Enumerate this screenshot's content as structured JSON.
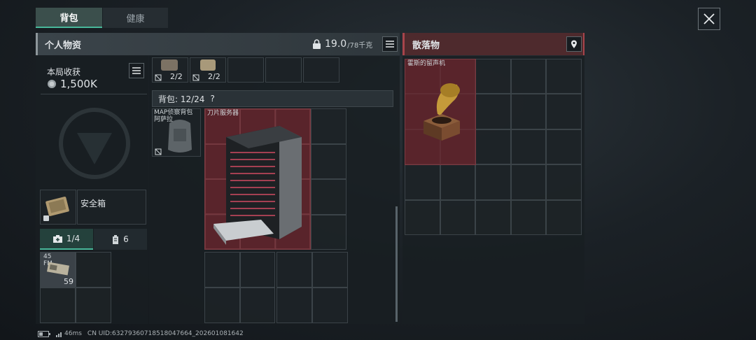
{
  "tabs": {
    "backpack": "背包",
    "health": "健康"
  },
  "personal": {
    "title": "个人物资",
    "weight_value": "19.0",
    "weight_capacity": "/78千克"
  },
  "loot": {
    "title": "散落物",
    "item_name": "霍斯的留声机"
  },
  "earnings": {
    "label": "本局收获",
    "value": "1,500K"
  },
  "ammo_counts": [
    "2/2",
    "2/2"
  ],
  "backpack": {
    "label": "背包: 12/24",
    "help": "?",
    "bag_name": "MAP侦察背包\n阿萨拉",
    "server_name": "刀片服务器"
  },
  "safebox": {
    "label": "安全箱"
  },
  "subtabs": {
    "medkit_count": "1/4",
    "ammo_count": "6"
  },
  "slot_item": {
    "top_label": "45\nFM",
    "count": "59"
  },
  "footer": {
    "latency": "46ms",
    "uid": "CN UID:632793607185180476​64_202601081642"
  },
  "icons": [
    "close-icon",
    "lock-icon",
    "list-icon",
    "pin-icon",
    "coin-icon",
    "help-icon",
    "medkit-icon",
    "ammo-icon",
    "battery-icon",
    "signal-icon"
  ],
  "colors": {
    "accent": "#48b89a",
    "loot_red": "#a8444b",
    "item_red": "#6e262e"
  }
}
